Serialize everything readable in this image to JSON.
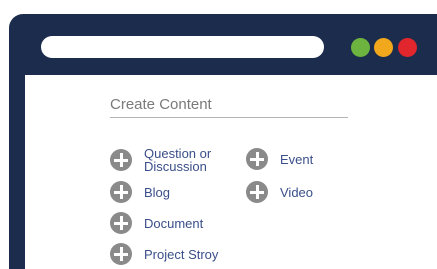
{
  "window": {
    "controls": [
      "green",
      "orange",
      "red"
    ],
    "colors": {
      "frame": "#1c2c4c",
      "green": "#6db33f",
      "orange": "#f2a81d",
      "red": "#e1262d",
      "link": "#3a4f8a"
    }
  },
  "create_content": {
    "heading": "Create Content",
    "left_items": [
      {
        "label": "Question or Discussion",
        "icon": "plus-circle-icon"
      },
      {
        "label": "Blog",
        "icon": "plus-circle-icon"
      },
      {
        "label": "Document",
        "icon": "plus-circle-icon"
      },
      {
        "label": "Project Stroy",
        "icon": "plus-circle-icon"
      }
    ],
    "right_items": [
      {
        "label": "Event",
        "icon": "plus-circle-icon"
      },
      {
        "label": "Video",
        "icon": "plus-circle-icon"
      }
    ]
  }
}
